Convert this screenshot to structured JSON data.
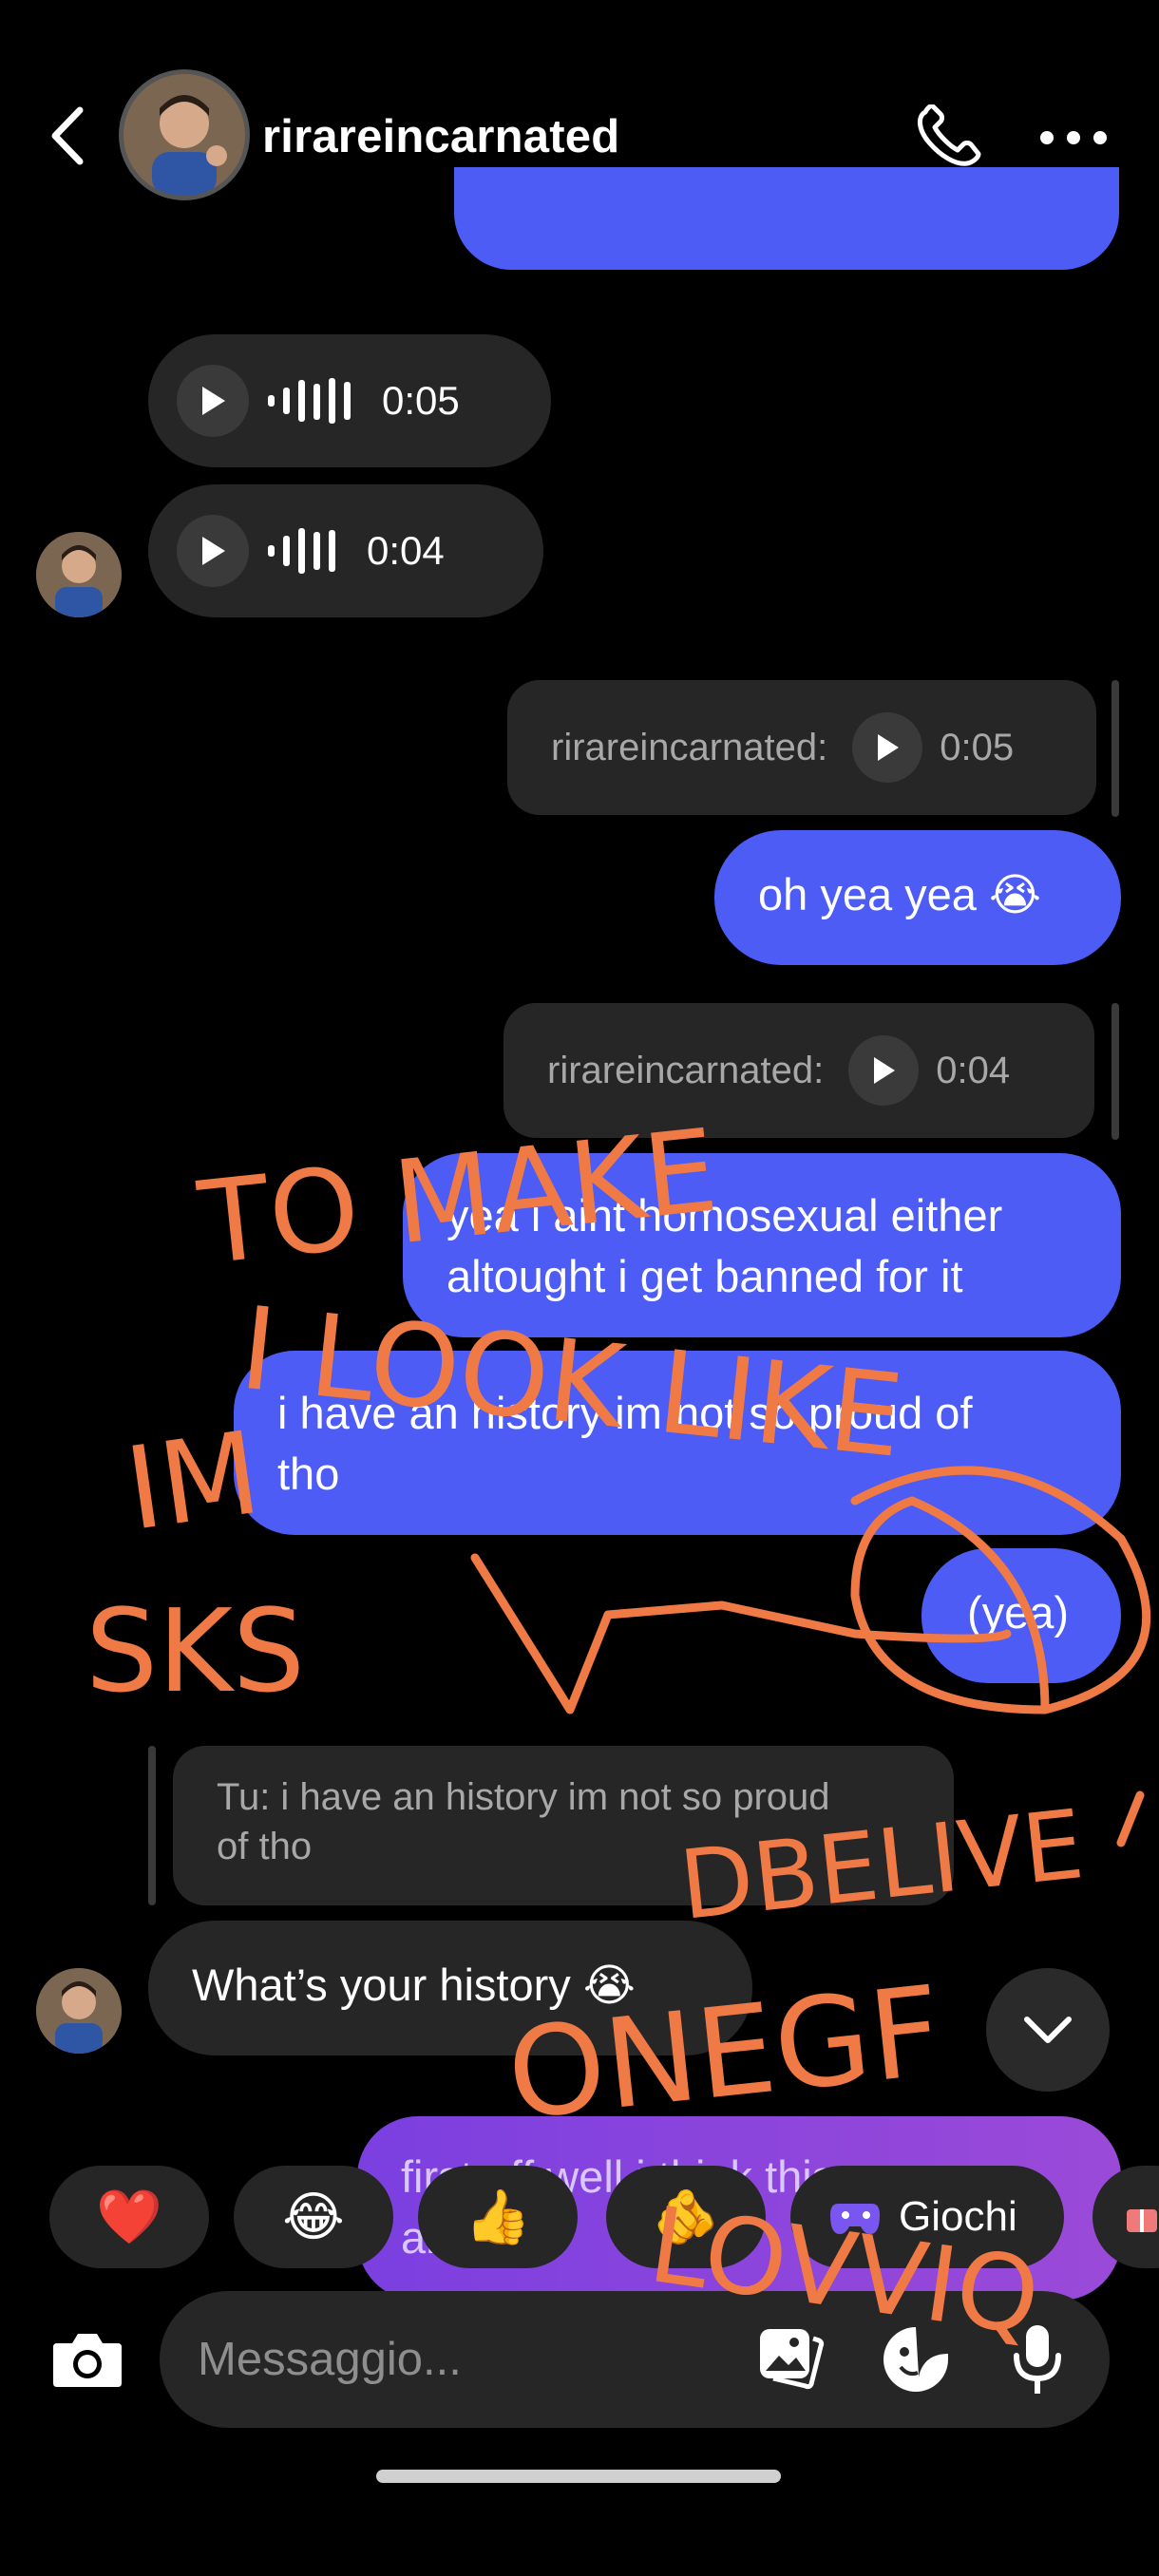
{
  "header": {
    "username": "rirareincarnated"
  },
  "messages": {
    "voice1_duration": "0:05",
    "voice2_duration": "0:04",
    "reply1_sender": "rirareincarnated:",
    "reply1_duration": "0:05",
    "msg_oh_yea": "oh yea yea 😭",
    "reply2_sender": "rirareincarnated:",
    "reply2_duration": "0:04",
    "msg_homosexual_line1": "yea i aint homosexual either",
    "msg_homosexual_line2": "altought i get banned for it",
    "msg_history_line1": "i have an history im not so proud of",
    "msg_history_line2": "tho",
    "msg_yea": "(yea)",
    "reply3_line1": "Tu: i have an history im not so proud",
    "reply3_line2": "of tho",
    "msg_whats_history": "What’s your history 😭",
    "msg_partial_line1": "first off well i think this",
    "msg_partial_line2": "anyone"
  },
  "reactions": [
    "❤️",
    "😂",
    "👍",
    "🫵"
  ],
  "games_label": "Giochi",
  "composer": {
    "placeholder": "Messaggio..."
  },
  "annotations": {
    "a1": "TO MAKE",
    "a2": "IM",
    "a3": "I LOOK LIKE",
    "a4": "SKS",
    "a5": "DBELIVE",
    "a6": "ONEGF",
    "a7": "LOVVIQ"
  },
  "colors": {
    "accent_blue": "#4c5cf5",
    "bubble_grey": "#262626",
    "annotation_orange": "#f07a45"
  }
}
